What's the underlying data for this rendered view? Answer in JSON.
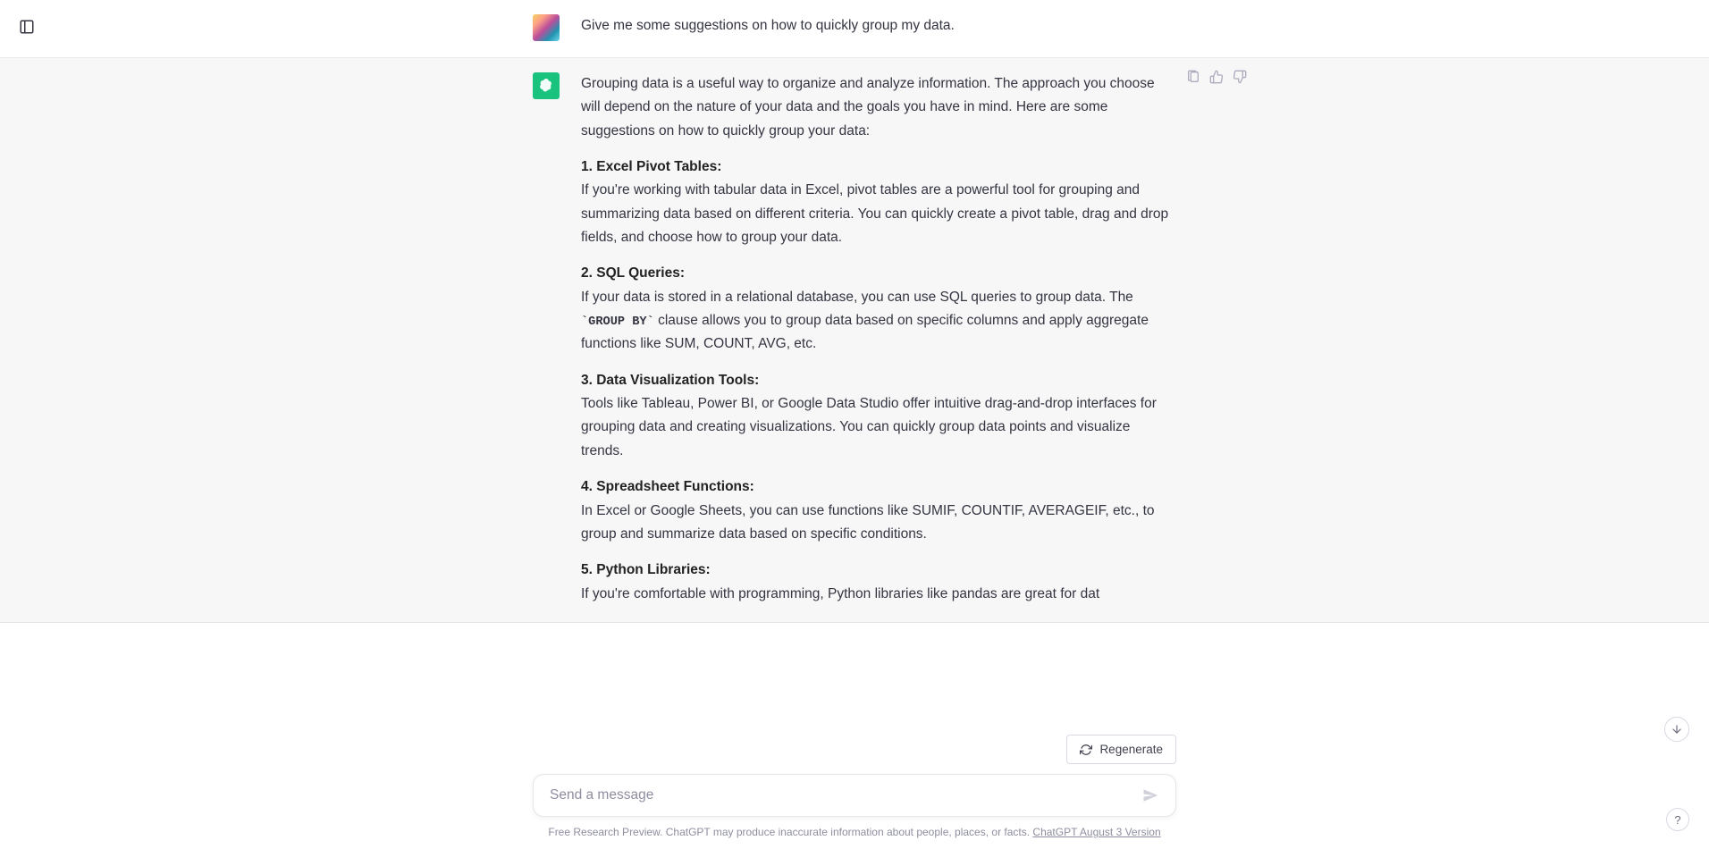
{
  "user_message": "Give me some suggestions on how to quickly group my data.",
  "assistant": {
    "intro": "Grouping data is a useful way to organize and analyze information. The approach you choose will depend on the nature of your data and the goals you have in mind. Here are some suggestions on how to quickly group your data:",
    "points": [
      {
        "title": "1. Excel Pivot Tables:",
        "body": "If you're working with tabular data in Excel, pivot tables are a powerful tool for grouping and summarizing data based on different criteria. You can quickly create a pivot table, drag and drop fields, and choose how to group your data."
      },
      {
        "title": "2. SQL Queries:",
        "body_pre": "If your data is stored in a relational database, you can use SQL queries to group data. The ",
        "code": "`GROUP BY`",
        "body_post": " clause allows you to group data based on specific columns and apply aggregate functions like SUM, COUNT, AVG, etc."
      },
      {
        "title": "3. Data Visualization Tools:",
        "body": "Tools like Tableau, Power BI, or Google Data Studio offer intuitive drag-and-drop interfaces for grouping data and creating visualizations. You can quickly group data points and visualize trends."
      },
      {
        "title": "4. Spreadsheet Functions:",
        "body": "In Excel or Google Sheets, you can use functions like SUMIF, COUNTIF, AVERAGEIF, etc., to group and summarize data based on specific conditions."
      },
      {
        "title": "5. Python Libraries:",
        "body": "If you're comfortable with programming, Python libraries like pandas are great for dat"
      }
    ]
  },
  "regenerate_label": "Regenerate",
  "input_placeholder": "Send a message",
  "footer_text": "Free Research Preview. ChatGPT may produce inaccurate information about people, places, or facts. ",
  "footer_link": "ChatGPT August 3 Version",
  "help_label": "?"
}
